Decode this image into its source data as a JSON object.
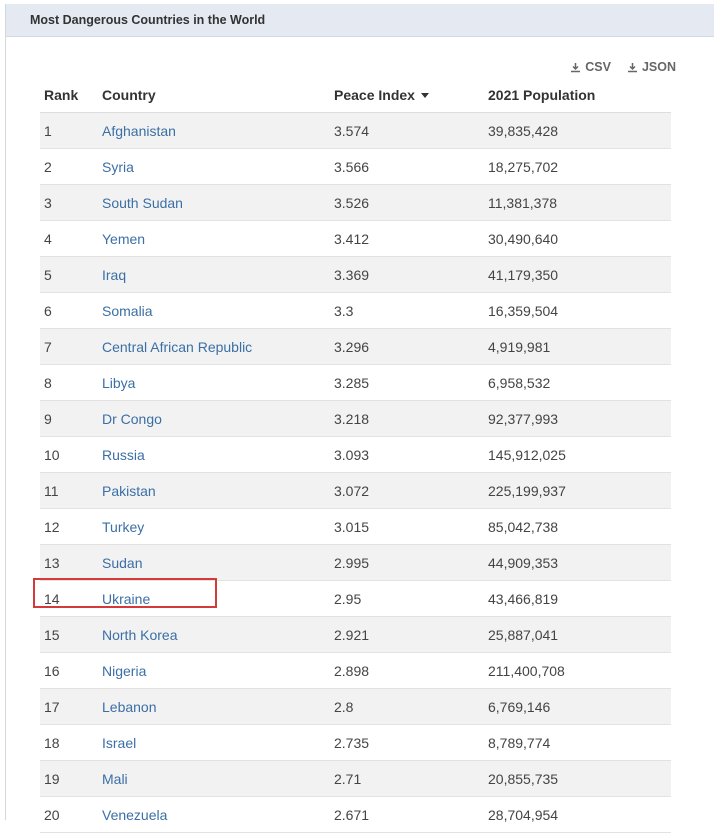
{
  "panel": {
    "title": "Most Dangerous Countries in the World"
  },
  "downloads": {
    "csv_label": "CSV",
    "json_label": "JSON"
  },
  "table": {
    "headers": {
      "rank": "Rank",
      "country": "Country",
      "peace_index": "Peace Index",
      "population": "2021 Population"
    },
    "sorted_by": "Peace Index",
    "rows": [
      {
        "rank": "1",
        "country": "Afghanistan",
        "peace_index": "3.574",
        "population": "39,835,428"
      },
      {
        "rank": "2",
        "country": "Syria",
        "peace_index": "3.566",
        "population": "18,275,702"
      },
      {
        "rank": "3",
        "country": "South Sudan",
        "peace_index": "3.526",
        "population": "11,381,378"
      },
      {
        "rank": "4",
        "country": "Yemen",
        "peace_index": "3.412",
        "population": "30,490,640"
      },
      {
        "rank": "5",
        "country": "Iraq",
        "peace_index": "3.369",
        "population": "41,179,350"
      },
      {
        "rank": "6",
        "country": "Somalia",
        "peace_index": "3.3",
        "population": "16,359,504"
      },
      {
        "rank": "7",
        "country": "Central African Republic",
        "peace_index": "3.296",
        "population": "4,919,981"
      },
      {
        "rank": "8",
        "country": "Libya",
        "peace_index": "3.285",
        "population": "6,958,532"
      },
      {
        "rank": "9",
        "country": "Dr Congo",
        "peace_index": "3.218",
        "population": "92,377,993"
      },
      {
        "rank": "10",
        "country": "Russia",
        "peace_index": "3.093",
        "population": "145,912,025"
      },
      {
        "rank": "11",
        "country": "Pakistan",
        "peace_index": "3.072",
        "population": "225,199,937"
      },
      {
        "rank": "12",
        "country": "Turkey",
        "peace_index": "3.015",
        "population": "85,042,738"
      },
      {
        "rank": "13",
        "country": "Sudan",
        "peace_index": "2.995",
        "population": "44,909,353"
      },
      {
        "rank": "14",
        "country": "Ukraine",
        "peace_index": "2.95",
        "population": "43,466,819"
      },
      {
        "rank": "15",
        "country": "North Korea",
        "peace_index": "2.921",
        "population": "25,887,041"
      },
      {
        "rank": "16",
        "country": "Nigeria",
        "peace_index": "2.898",
        "population": "211,400,708"
      },
      {
        "rank": "17",
        "country": "Lebanon",
        "peace_index": "2.8",
        "population": "6,769,146"
      },
      {
        "rank": "18",
        "country": "Israel",
        "peace_index": "2.735",
        "population": "8,789,774"
      },
      {
        "rank": "19",
        "country": "Mali",
        "peace_index": "2.71",
        "population": "20,855,735"
      },
      {
        "rank": "20",
        "country": "Venezuela",
        "peace_index": "2.671",
        "population": "28,704,954"
      }
    ],
    "highlighted_rank": "14"
  },
  "colors": {
    "header_bg": "#e4e9f2",
    "link": "#3b6fa5",
    "stripe": "#f2f2f2",
    "highlight": "#d43a3a"
  },
  "icons": {
    "download": "download-icon",
    "sort": "sort-desc-icon"
  }
}
